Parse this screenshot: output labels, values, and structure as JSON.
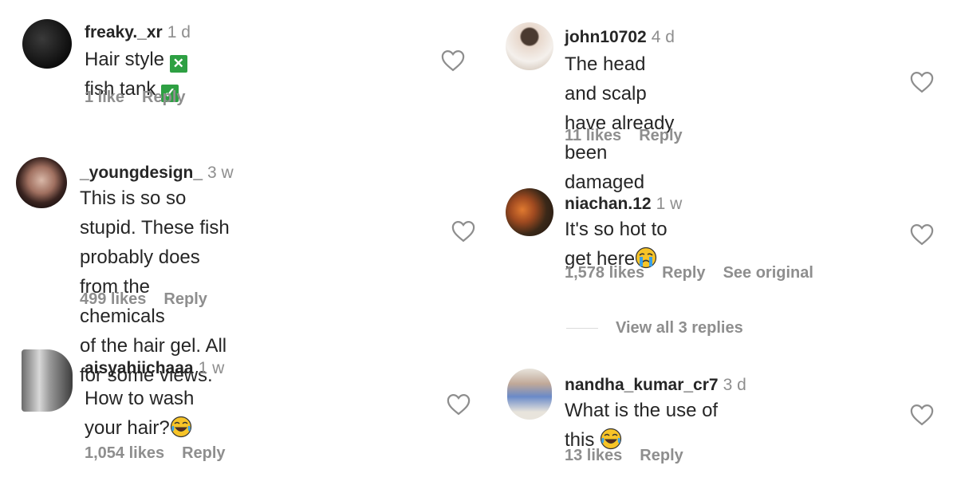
{
  "left_column": [
    {
      "username": "freaky._xr",
      "time": "1 d",
      "text_parts": [
        "Hair style",
        "fish tank"
      ],
      "likes": "1 like",
      "reply": "Reply"
    },
    {
      "username": "_youngdesign_",
      "time": "3 w",
      "text_lines": [
        "This is so so stupid. These fish",
        "probably does from the chemicals",
        "of the hair gel. All for some views."
      ],
      "likes": "499 likes",
      "reply": "Reply"
    },
    {
      "username": "aisyahiichaaa",
      "time": "1 w",
      "text": "How to wash your hair?",
      "likes": "1,054 likes",
      "reply": "Reply"
    }
  ],
  "right_column": [
    {
      "username": "john10702",
      "time": "4 d",
      "text_lines": [
        "The head and scalp have already",
        "been damaged"
      ],
      "likes": "11 likes",
      "reply": "Reply"
    },
    {
      "username": "niachan.12",
      "time": "1 w",
      "text": "It's so hot to get here",
      "likes": "1,578 likes",
      "reply": "Reply",
      "see_original": "See original",
      "view_replies": "View all 3 replies"
    },
    {
      "username": "nandha_kumar_cr7",
      "time": "3 d",
      "text": "What is the use of this",
      "likes": "13 likes",
      "reply": "Reply"
    }
  ],
  "colors": {
    "text": "#262626",
    "muted": "#8e8e8e",
    "check_green": "#2ea043"
  },
  "icons": [
    "heart-outline-icon",
    "cross-mark-button-emoji",
    "check-mark-button-emoji",
    "crying-face-emoji",
    "tears-of-joy-emoji"
  ]
}
